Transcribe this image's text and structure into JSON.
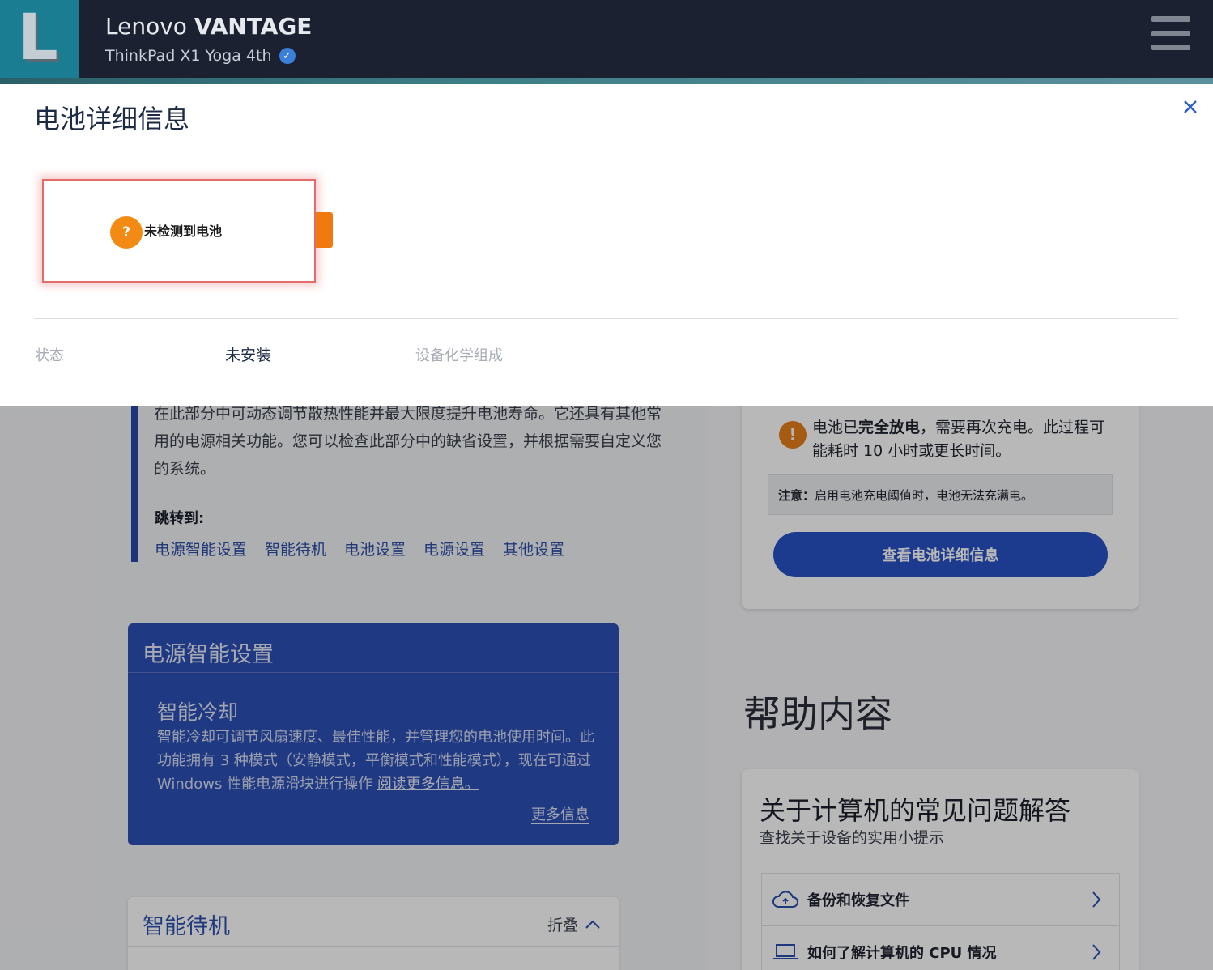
{
  "header": {
    "logo_letter": "L",
    "brand": "Lenovo",
    "product": "VANTAGE",
    "device": "ThinkPad X1 Yoga 4th"
  },
  "background": {
    "intro_text": "在此部分中可动态调节散热性能并最大限度提升电池寿命。它还具有其他常用的电源相关功能。您可以检查此部分中的缺省设置，并根据需要自定义您的系统。",
    "jump_label": "跳转到:",
    "jump_links": [
      "电源智能设置",
      "智能待机",
      "电池设置",
      "电源设置",
      "其他设置"
    ],
    "power_card": {
      "title": "电源智能设置",
      "sub_title": "智能冷却",
      "description": "智能冷却可调节风扇速度、最佳性能，并管理您的电池使用时间。此功能拥有 3 种模式（安静模式，平衡模式和性能模式），现在可通过 Windows 性能电源滑块进行操作",
      "read_more": "阅读更多信息。",
      "more_info": "更多信息"
    },
    "standby_card": {
      "title": "智能待机",
      "collapse": "折叠"
    },
    "battery_card": {
      "warning_pre": "电池已",
      "warning_bold": "完全放电",
      "warning_post": "，需要再次充电。此过程可能耗时 10 小时或更长时间。",
      "note_label": "注意：",
      "note_text": "启用电池充电阈值时，电池无法充满电。",
      "button": "查看电池详细信息"
    },
    "help": {
      "title": "帮助内容",
      "faq_title": "关于计算机的常见问题解答",
      "faq_sub": "查找关于设备的实用小提示",
      "items": [
        {
          "label": "备份和恢复文件",
          "icon": "cloud-sync-icon"
        },
        {
          "label": "如何了解计算机的 CPU 情况",
          "icon": "laptop-icon"
        }
      ]
    }
  },
  "modal": {
    "title": "电池详细信息",
    "battery_status_text": "未检测到电池",
    "question_mark": "?",
    "fields": {
      "status_label": "状态",
      "status_value": "未安装",
      "chemistry_label": "设备化学组成"
    }
  },
  "colors": {
    "header_bg": "#1c2132",
    "logo_bg": "#1b7d92",
    "accent_blue": "#2753c7",
    "battery_orange": "#f07a10",
    "warning_orange": "#e77e1b",
    "highlight_red": "#e56b6b"
  }
}
